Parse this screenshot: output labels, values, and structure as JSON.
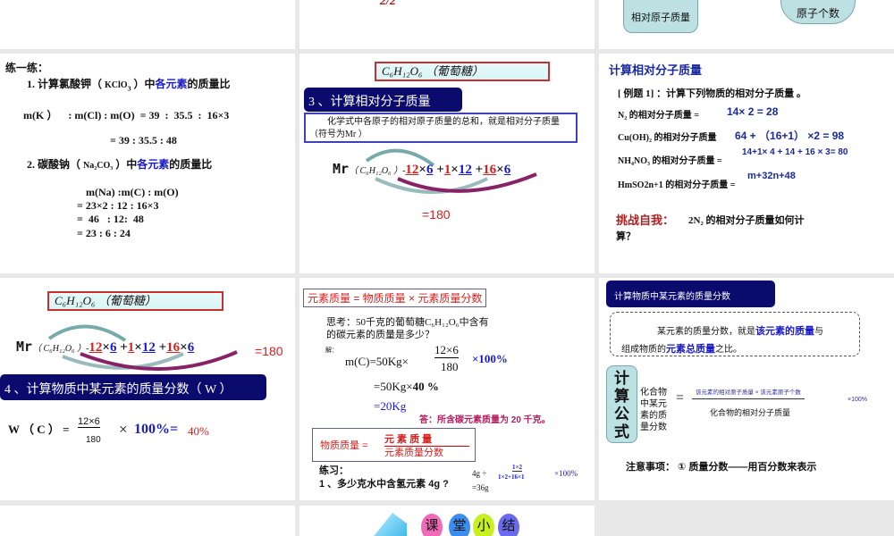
{
  "slides": {
    "top_left": {},
    "top_mid": {
      "fragment": "2/2"
    },
    "top_right": {
      "box1": "相对原子质量",
      "box2": "原子个数"
    },
    "s1": {
      "title": "练一练：",
      "q1_pre": "1. 计算氯酸钾（ ",
      "q1_formula": "KClO",
      "q1_sub": "3",
      "q1_mid": " ）中",
      "q1_hl": "各元素",
      "q1_post": "的质量比",
      "l1": "m(K ）    : m(Cl) : m(O)  = 39  :  35.5  :  16×3",
      "l2": "= 39  :  35.5  :   48",
      "q2_pre": "2. 碳酸钠（  ",
      "q2_formula": "Na₂CO₃",
      "q2_mid": " ）中",
      "q2_hl": "各元素",
      "q2_post": "的质量比",
      "r1": "m(Na)  :m(C) :  m(O)",
      "r2": "=  23×2  :  12  :  16×3",
      "r3": "=  46   : 12:  48",
      "r4": "=  23  :  6  :  24"
    },
    "s2": {
      "glucose": "C₆H₁₂O₆ （葡萄糖）",
      "heading": "3 、计算相对分子质量",
      "def": "化学式中各原子的相对原子质量的总和，就是相对分子质量（符号为Mr ）",
      "mr": "Mr",
      "formula": "（ C₆H₁₂O₆ ）-",
      "t1": "12",
      "x1": "×",
      "t2": "6",
      "p1": "+",
      "t3": "1",
      "x2": "×",
      "t4": "12",
      "p2": "+",
      "t5": "16",
      "x3": "×",
      "t6": "6",
      "result": "=180"
    },
    "s3": {
      "title": "计算相对分子质量",
      "example": "[ 例题 1] ：计算下列物质的相对分子质量  。",
      "rows": [
        {
          "label": "N₂  的相对分子质量 =",
          "ans": "14× 2 = 28"
        },
        {
          "label": "Cu(OH)₂ 的相对分子质量",
          "ans": "64 +  （16+1）  ×2 = 98"
        },
        {
          "label": "NH₄NO₃ 的相对分子质量 =",
          "ans": "14+1× 4 + 14 + 16 × 3= 80"
        },
        {
          "label": "HmSO2n+1 的相对分子质量 =",
          "ans": "m+32n+48"
        }
      ],
      "challenge": "挑战自我：",
      "challenge_q": "2N₂  的相对分子质量如何计",
      "challenge_q2": "算？"
    },
    "s4": {
      "glucose": "C₆H₁₂O₆ （葡萄糖）",
      "mr": "Mr",
      "formula": "（ C₆H₁₂O₆ ）-",
      "t1": "12",
      "t2": "6",
      "t3": "1",
      "t4": "12",
      "t5": "16",
      "t6": "6",
      "x": "×",
      "p": "+",
      "result": "=180",
      "heading": "4 、计算物质中某元素的质量分数（ W ）",
      "w": "W （ C ） =",
      "num": "12×6",
      "den": "180",
      "times": "×",
      "pct": "100%=",
      "ans": "40%"
    },
    "s5": {
      "rule": "元素质量 = 物质质量   ×  元素质量分数",
      "think1": "思考：50千克的葡萄糖C₆H₁₂O₆中含有",
      "think2": "的碳元素的质量是多少？",
      "jie": "解：",
      "m1": "m(C)=50Kg×",
      "num": "12×6",
      "den": "180",
      "pct": "×100%",
      "m2a": "=50Kg×",
      "m2b": "40 %",
      "m3": "=20Kg",
      "answer": "答：所含碳元素质量为 20 千克。",
      "f_left": "物质质量  =",
      "f_num": "元 素 质  量",
      "f_den": "元素质量分数",
      "ex_title": "练习：",
      "ex_q": "1 、多少克水中含氢元素 4g ?",
      "ex_a1": "4g ÷",
      "ex_num": "1×2",
      "ex_den": "1×2+16×1",
      "ex_pct": "×100%",
      "ex_a2": "=36g"
    },
    "s6": {
      "heading": "计算物质中某元素的质量分数",
      "def1": "某元素的质量分数，就是",
      "def1_hl": "该元素的质量",
      "def1_post": "与",
      "def2_pre": "组成物质的",
      "def2_hl": "元素总质量",
      "def2_post": "之比。",
      "formula_tag": "计算公式",
      "left": "化合物中某元素的质量分数",
      "eq": "=",
      "num": "该元素的相对原子质量 × 该元素原子个数",
      "den": "化合物的相对分子质量",
      "pct": "×100%",
      "note": "注意事项：  ① 质量分数——用百分数来表示"
    },
    "s8": {
      "chars": [
        "课",
        "堂",
        "小",
        "结"
      ],
      "colors": [
        "#f06ab8",
        "#3b8ef0",
        "#c8f020",
        "#6a6af0"
      ]
    }
  }
}
